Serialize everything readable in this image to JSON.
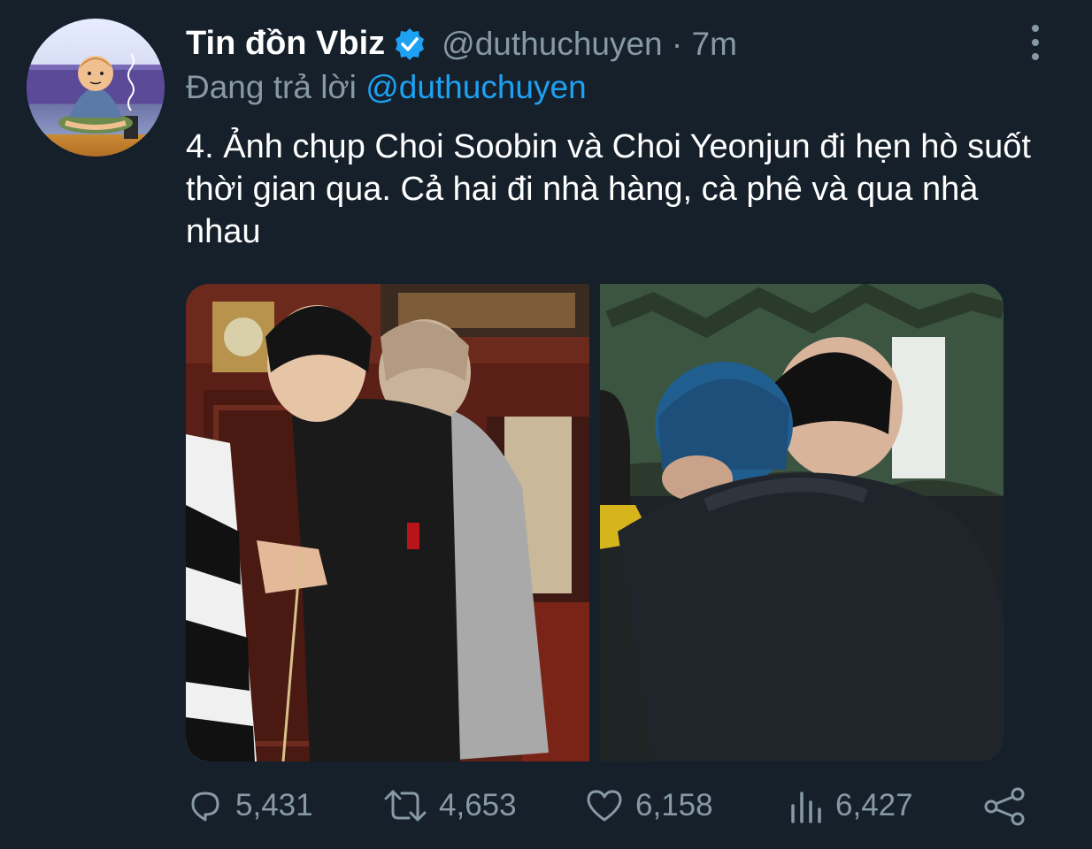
{
  "tweet": {
    "display_name": "Tin đồn Vbiz",
    "handle": "@duthuchuyen",
    "separator": "·",
    "time": "7m",
    "replying_prefix": "Đang trả lời",
    "replying_to": "@duthuchuyen",
    "text": "4. Ảnh chụp Choi Soobin và Choi Yeonjun đi hẹn hò suốt thời gian qua. Cả hai đi nhà hàng, cà phê và qua nhà nhau",
    "verified": true
  },
  "actions": {
    "replies": "5,431",
    "retweets": "4,653",
    "likes": "6,158",
    "views": "6,427"
  },
  "icons": {
    "more": "more-vertical-icon",
    "reply": "comment-icon",
    "retweet": "retweet-icon",
    "like": "heart-icon",
    "views": "bar-chart-icon",
    "share": "share-icon",
    "verified": "verified-badge-icon"
  },
  "colors": {
    "background": "#15202b",
    "secondary_text": "#8899a6",
    "accent": "#1da1f2"
  }
}
